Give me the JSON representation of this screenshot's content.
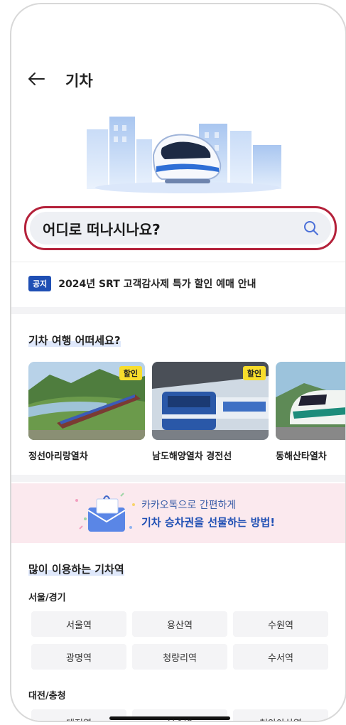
{
  "header": {
    "title": "기차"
  },
  "search": {
    "placeholder": "어디로 떠나시나요?"
  },
  "notice": {
    "badge": "공지",
    "text": "2024년 SRT 고객감사제 특가 할인 예매 안내"
  },
  "trips_section": {
    "title": "기차 여행 어떠세요?",
    "items": [
      {
        "name": "정선아리랑열차",
        "badge": "할인"
      },
      {
        "name": "남도해양열차 경전선",
        "badge": "할인"
      },
      {
        "name": "동해산타열차",
        "badge": ""
      }
    ]
  },
  "promo": {
    "line1": "카카오톡으로 간편하게",
    "line2": "기차 승차권을 선물하는 방법!"
  },
  "stations_section": {
    "title": "많이 이용하는 기차역",
    "groups": [
      {
        "region": "서울/경기",
        "stations": [
          "서울역",
          "용산역",
          "수원역",
          "광명역",
          "청량리역",
          "수서역"
        ]
      },
      {
        "region": "대전/충청",
        "stations": [
          "대전역",
          "오송역",
          "천안아산역"
        ]
      }
    ]
  },
  "colors": {
    "accent": "#1f4fb4",
    "badge_yellow": "#f8dd2c",
    "highlight_ring": "#b4213a",
    "promo_bg": "#fbe9ee"
  }
}
